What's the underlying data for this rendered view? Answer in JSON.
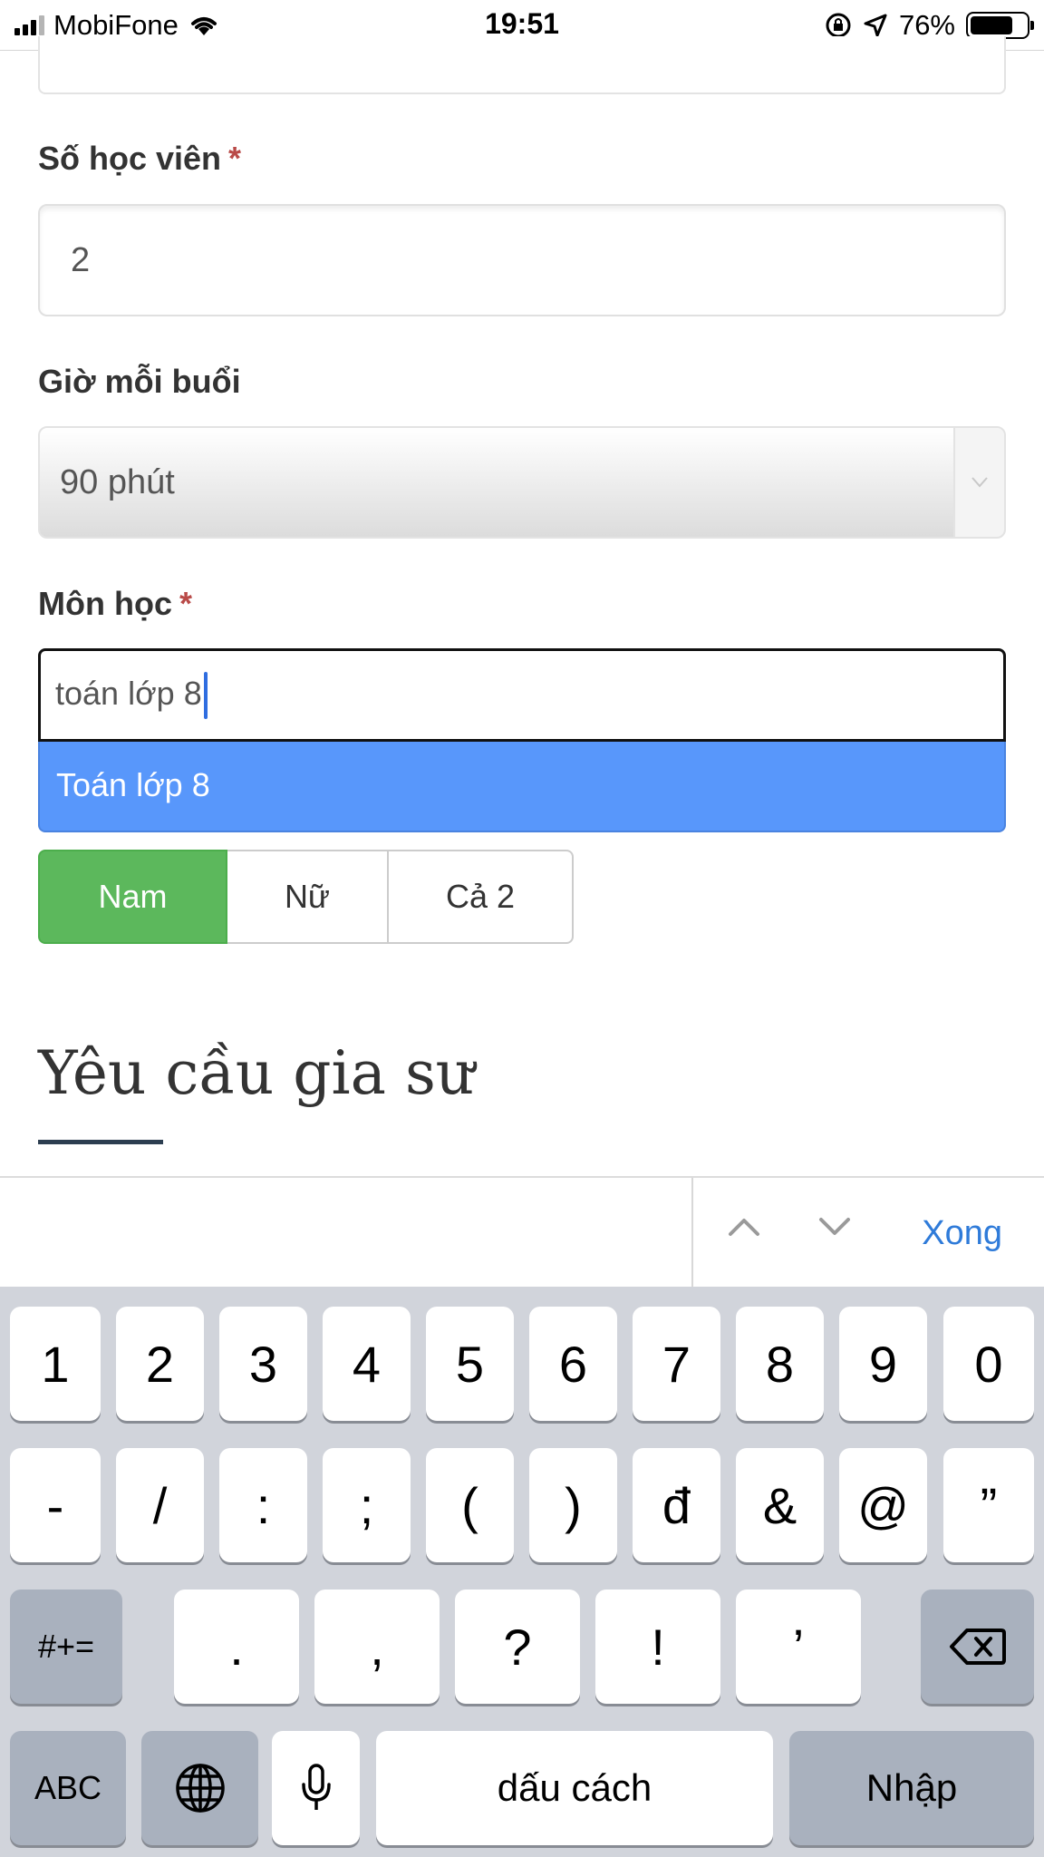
{
  "status_bar": {
    "carrier": "MobiFone",
    "time": "19:51",
    "battery": "76%",
    "battery_level": 0.76,
    "icons": [
      "signal-icon",
      "wifi-icon",
      "orientation-lock-icon",
      "location-icon",
      "battery-icon"
    ]
  },
  "form": {
    "students_label": "Số học viên",
    "students_required": "*",
    "students_value": "2",
    "hours_label": "Giờ mỗi buổi",
    "hours_value": "90 phút",
    "subject_label": "Môn học",
    "subject_required": "*",
    "subject_value": "toán lớp 8",
    "subject_suggestion": "Toán lớp 8",
    "gender_options": [
      "Nam",
      "Nữ",
      "Cả 2"
    ],
    "gender_selected": "Nam"
  },
  "section": {
    "title": "Yêu cầu gia sư"
  },
  "accessory_bar": {
    "done_label": "Xong",
    "icons": [
      "chevron-up-icon",
      "chevron-down-icon"
    ]
  },
  "keyboard": {
    "row1": [
      "1",
      "2",
      "3",
      "4",
      "5",
      "6",
      "7",
      "8",
      "9",
      "0"
    ],
    "row2": [
      "-",
      "/",
      ":",
      ";",
      "(",
      ")",
      "đ",
      "&",
      "@",
      "”"
    ],
    "row3": [
      "#+=",
      ".",
      ",",
      "?",
      "!",
      "’"
    ],
    "abc_label": "ABC",
    "space_label": "dấu cách",
    "return_label": "Nhập",
    "icons": [
      "globe-icon",
      "microphone-icon",
      "backspace-icon"
    ]
  },
  "colors": {
    "accent_green": "#5cb85c",
    "suggestion_blue": "#5897fb",
    "required_red": "#b94a48",
    "done_blue": "#2f7bd9",
    "keyboard_bg": "#d1d4db"
  }
}
